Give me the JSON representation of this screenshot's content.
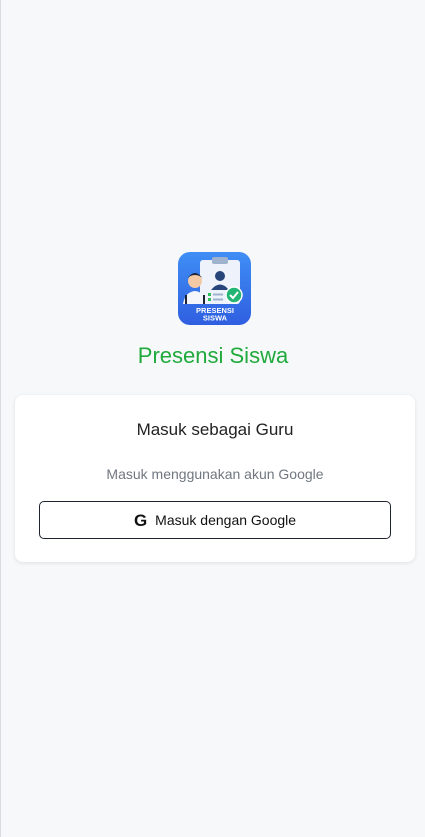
{
  "app": {
    "title": "Presensi Siswa",
    "logo_text_line1": "PRESENSI",
    "logo_text_line2": "SISWA",
    "accent_color": "#1faa3b"
  },
  "login_card": {
    "title": "Masuk sebagai Guru",
    "subtitle": "Masuk menggunakan akun Google",
    "google_button": {
      "icon": "google-icon",
      "icon_glyph": "G",
      "label": "Masuk dengan Google"
    }
  }
}
